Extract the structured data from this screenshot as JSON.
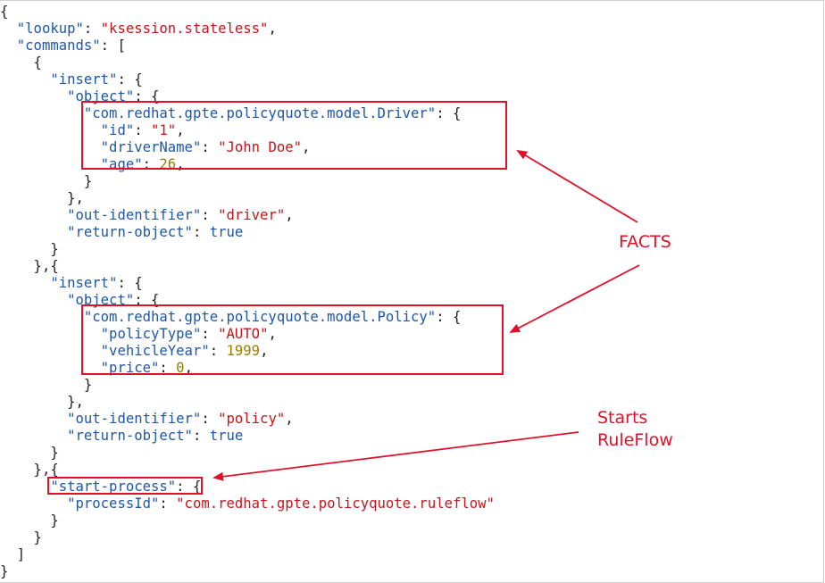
{
  "code": {
    "lookup_key": "\"lookup\"",
    "lookup_value": "\"ksession.stateless\"",
    "commands_key": "\"commands\"",
    "insert_key": "\"insert\"",
    "object_key": "\"object\"",
    "driver_class": "\"com.redhat.gpte.policyquote.model.Driver\"",
    "id_key": "\"id\"",
    "id_value": "\"1\"",
    "driverName_key": "\"driverName\"",
    "driverName_value": "\"John Doe\"",
    "age_key": "\"age\"",
    "age_value": "26",
    "out_identifier_key": "\"out-identifier\"",
    "out_identifier_driver": "\"driver\"",
    "return_object_key": "\"return-object\"",
    "return_object_value": "true",
    "policy_class": "\"com.redhat.gpte.policyquote.model.Policy\"",
    "policyType_key": "\"policyType\"",
    "policyType_value": "\"AUTO\"",
    "vehicleYear_key": "\"vehicleYear\"",
    "vehicleYear_value": "1999",
    "price_key": "\"price\"",
    "price_value": "0",
    "out_identifier_policy": "\"policy\"",
    "start_process_key": "\"start-process\"",
    "processId_key": "\"processId\"",
    "processId_value": "\"com.redhat.gpte.policyquote.ruleflow\""
  },
  "annotations": {
    "facts_label": "FACTS",
    "starts_label_line1": "Starts",
    "starts_label_line2": "RuleFlow",
    "color": "#e0102a"
  }
}
